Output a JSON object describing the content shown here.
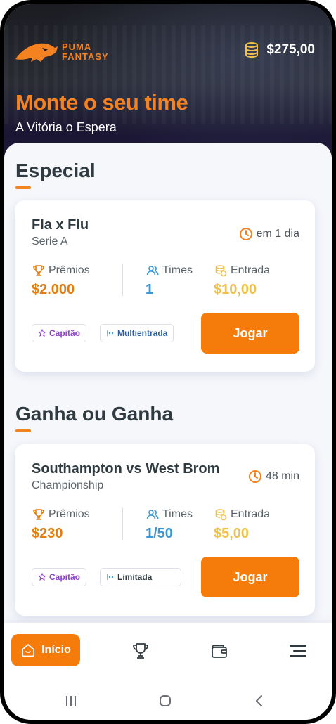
{
  "header": {
    "logo_line1": "PUMA",
    "logo_line2": "FANTASY",
    "balance": "$275,00",
    "title": "Monte o seu time",
    "subtitle": "A Vitória o Espera"
  },
  "colors": {
    "accent": "#f58220",
    "button": "#f57c0a",
    "prize": "#e57c10",
    "teams": "#3a97d4",
    "entry": "#f0c04a",
    "chip_captain": "#8e3fd0",
    "chip_blue": "#2d5d9b"
  },
  "sections": [
    {
      "title": "Especial",
      "card": {
        "match": "Fla x Flu",
        "league": "Serie A",
        "time": "em 1 dia",
        "prizes_label": "Prêmios",
        "prizes_value": "$2.000",
        "teams_label": "Times",
        "teams_value": "1",
        "entry_label": "Entrada",
        "entry_value": "$10,00",
        "chip1": "Capitão",
        "chip2": "Multientrada",
        "button": "Jogar"
      }
    },
    {
      "title": "Ganha ou Ganha",
      "card": {
        "match": "Southampton vs West Brom",
        "league": "Championship",
        "time": "48 min",
        "prizes_label": "Prêmios",
        "prizes_value": "$230",
        "teams_label": "Times",
        "teams_value": "1/50",
        "entry_label": "Entrada",
        "entry_value": "$5,00",
        "chip1": "Capitão",
        "chip2": "Limitada",
        "button": "Jogar"
      }
    }
  ],
  "nav": {
    "home_label": "Início",
    "icons": [
      "home-icon",
      "trophy-icon",
      "wallet-icon",
      "menu-icon"
    ]
  },
  "system_nav": {
    "icons": [
      "recents-icon",
      "home-circle-icon",
      "back-icon"
    ]
  }
}
